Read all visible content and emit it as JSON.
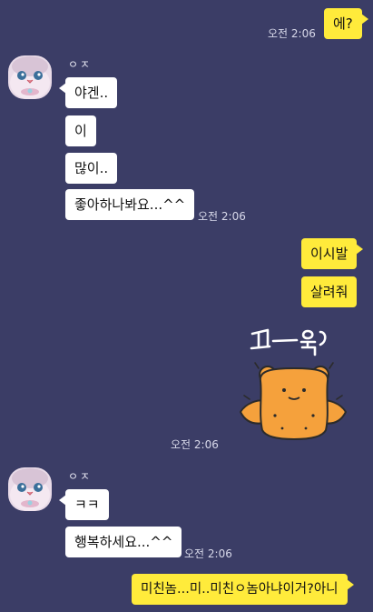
{
  "messages": {
    "m1": {
      "text": "에?",
      "time": "오전 2:06"
    },
    "group1": {
      "sender": "ㅇㅈ",
      "m1": "야겐..",
      "m2": "이",
      "m3": "많이..",
      "m4": "좋아하나봐요...^^",
      "time": "오전 2:06"
    },
    "m2": {
      "text": "이시발"
    },
    "m3": {
      "text": "살려줘"
    },
    "sticker": {
      "caption": "꾸—욱",
      "time": "오전 2:06"
    },
    "group2": {
      "sender": "ㅇㅈ",
      "m1": "ㅋㅋ",
      "m2": "행복하세요...^^",
      "time": "오전 2:06"
    },
    "m4": {
      "text": "미친놈...미..미친ㅇ놈아냐이거?아니"
    }
  },
  "colors": {
    "background": "#3b3d66",
    "incoming_bubble": "#ffffff",
    "outgoing_bubble": "#ffeb3b",
    "sticker_bear": "#f5a13c"
  },
  "icons": {
    "avatar": "character-avatar",
    "sticker": "bear-sticker"
  }
}
